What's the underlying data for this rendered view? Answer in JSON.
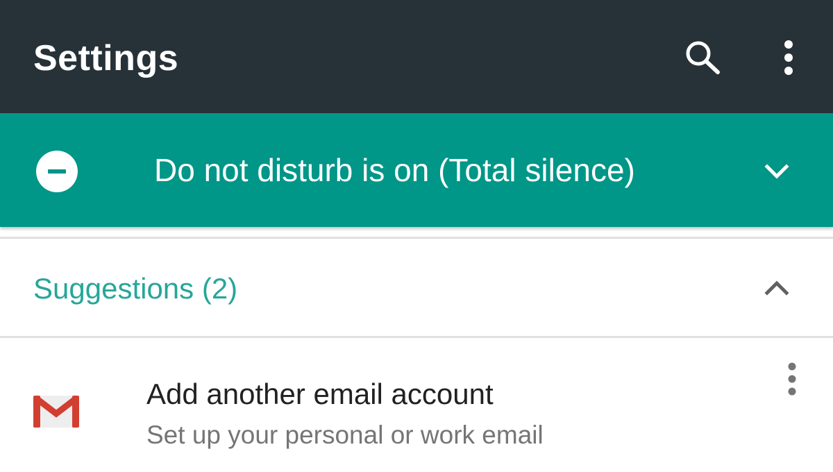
{
  "app_bar": {
    "title": "Settings",
    "search_icon": "search-icon",
    "more_icon": "more-vert-icon",
    "background": "#263238"
  },
  "dnd_banner": {
    "text": "Do not disturb is on (Total silence)",
    "status_icon": "do-not-disturb-icon",
    "expand_icon": "chevron-down-icon",
    "background": "#009688"
  },
  "suggestions": {
    "header_label": "Suggestions (2)",
    "collapse_icon": "chevron-up-icon",
    "accent": "#26a69a",
    "items": [
      {
        "title": "Add another email account",
        "subtitle": "Set up your personal or work email",
        "icon": "gmail-icon",
        "menu_icon": "more-vert-icon"
      }
    ]
  }
}
